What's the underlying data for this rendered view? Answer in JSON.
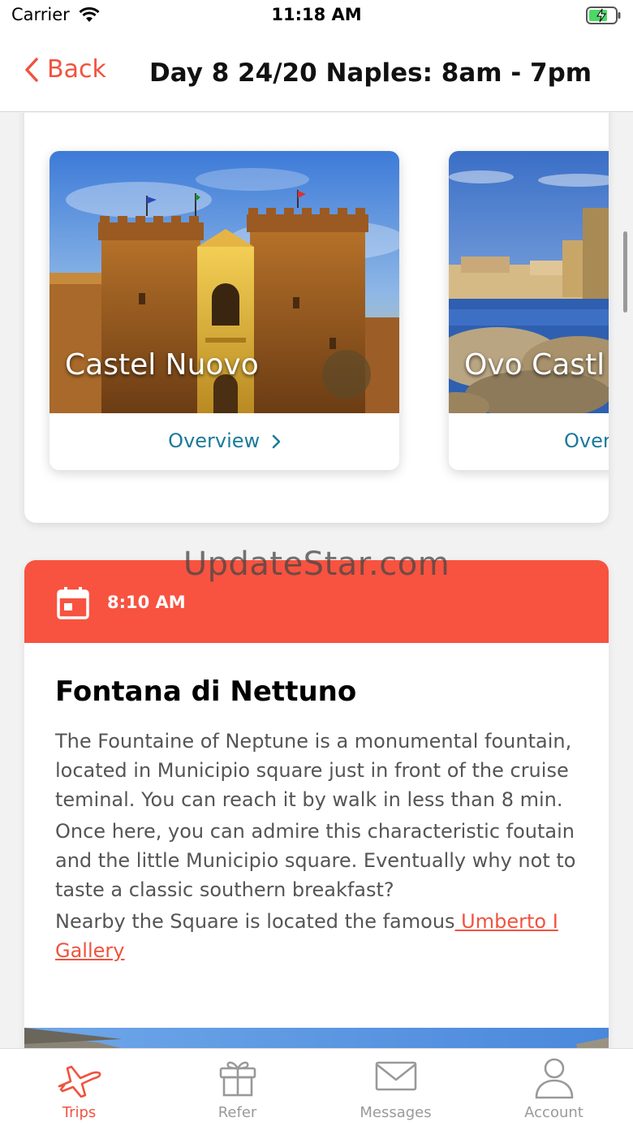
{
  "status_bar": {
    "carrier": "Carrier",
    "time": "11:18 AM"
  },
  "nav": {
    "back_label": "Back",
    "title": "Day 8 24/20 Naples: 8am - 7pm"
  },
  "attractions": [
    {
      "name": "Castel Nuovo",
      "link": "Overview"
    },
    {
      "name": "Ovo Castl",
      "link": "Over"
    }
  ],
  "watermark": "UpdateStar.com",
  "event": {
    "time": "8:10 AM",
    "title": "Fontana di Nettuno",
    "paragraph_1": "The Fountaine of Neptune is a monumental fountain, located in Municipio square just in front of the cruise teminal. You can reach it by walk in less than 8 min.",
    "paragraph_2": "Once here, you can admire this characteristic foutain and the little Municipio square. Eventually why not to taste a classic southern breakfast?",
    "paragraph_3_prefix": "Nearby the Square is located the famous",
    "paragraph_3_link": " Umberto I Gallery"
  },
  "tabs": [
    {
      "label": "Trips",
      "icon": "airplane-icon",
      "active": true
    },
    {
      "label": "Refer",
      "icon": "gift-icon",
      "active": false
    },
    {
      "label": "Messages",
      "icon": "envelope-icon",
      "active": false
    },
    {
      "label": "Account",
      "icon": "person-icon",
      "active": false
    }
  ],
  "colors": {
    "accent": "#f75340",
    "link_teal": "#1a7a9a"
  }
}
